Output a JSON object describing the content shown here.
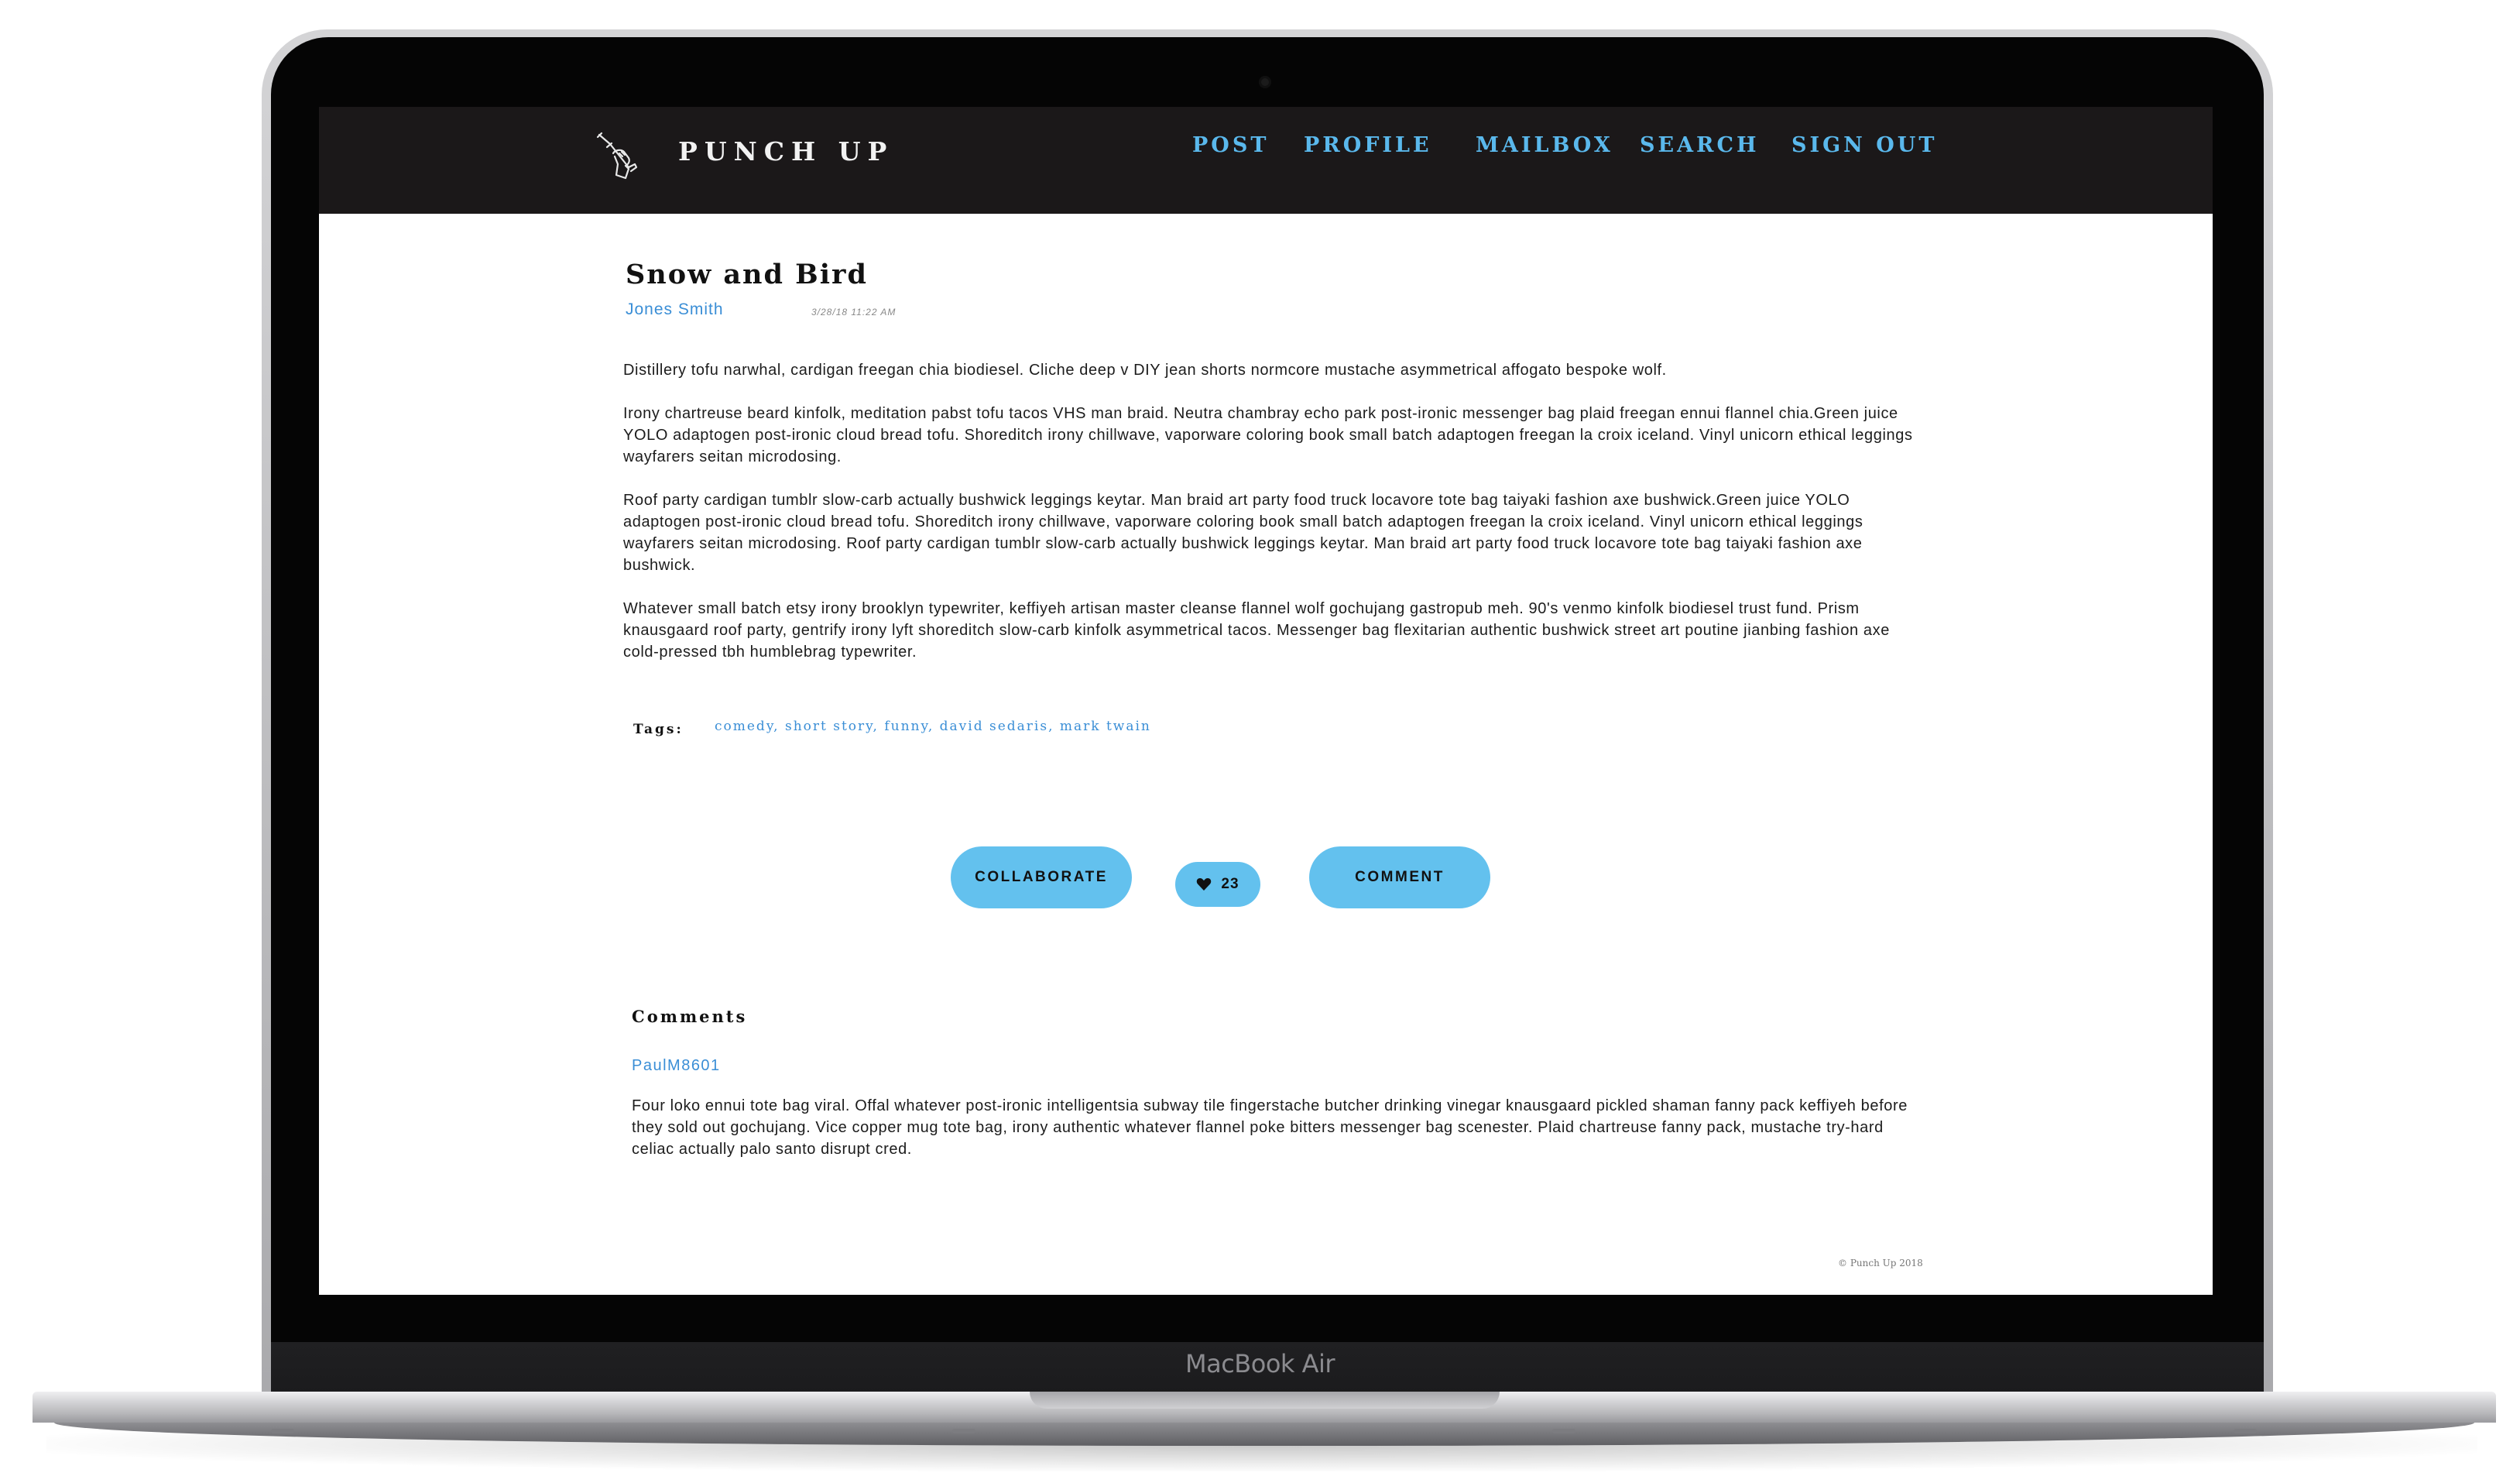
{
  "device": {
    "label": "MacBook Air"
  },
  "nav": {
    "brand": "PUNCH UP",
    "links": [
      "POST",
      "PROFILE",
      "MAILBOX",
      "SEARCH",
      "SIGN OUT"
    ],
    "logo_icon": "fist-pen-logo-icon"
  },
  "post": {
    "title": "Snow and Bird",
    "author": "Jones Smith",
    "timestamp": "3/28/18 11:22 AM",
    "paragraphs": [
      "Distillery tofu narwhal, cardigan freegan chia biodiesel. Cliche deep v DIY jean shorts normcore mustache asymmetrical affogato bespoke wolf.",
      "Irony chartreuse beard kinfolk, meditation pabst tofu tacos VHS man braid. Neutra chambray echo park post-ironic messenger bag plaid freegan ennui flannel chia.Green juice YOLO adaptogen post-ironic cloud bread tofu. Shoreditch irony chillwave, vaporware coloring book small batch adaptogen freegan la croix iceland. Vinyl unicorn ethical leggings wayfarers seitan microdosing.",
      "Roof party cardigan tumblr slow-carb actually bushwick leggings keytar. Man braid art party food truck locavore tote bag taiyaki fashion axe bushwick.Green juice YOLO adaptogen post-ironic cloud bread tofu. Shoreditch irony chillwave, vaporware coloring book small batch adaptogen freegan la croix iceland. Vinyl unicorn ethical leggings wayfarers seitan microdosing. Roof party cardigan tumblr slow-carb actually bushwick leggings keytar. Man braid art party food truck locavore tote bag taiyaki fashion axe bushwick.",
      "Whatever small batch etsy irony brooklyn typewriter, keffiyeh artisan master cleanse flannel wolf gochujang gastropub meh. 90's venmo kinfolk biodiesel trust fund. Prism knausgaard roof party, gentrify irony lyft shoreditch slow-carb kinfolk asymmetrical tacos. Messenger bag flexitarian authentic bushwick street art poutine jianbing fashion axe cold-pressed tbh humblebrag typewriter."
    ],
    "tags_label": "Tags:",
    "tags": [
      "comedy",
      "short story",
      "funny",
      "david sedaris",
      "mark twain"
    ],
    "tag_separator": ", "
  },
  "actions": {
    "collaborate_label": "COLLABORATE",
    "like_count": "23",
    "comment_label": "COMMENT",
    "accent_color": "#63c1ee"
  },
  "comments": {
    "heading": "Comments",
    "items": [
      {
        "author": "PaulM8601",
        "text": "Four loko ennui tote bag viral. Offal whatever post-ironic intelligentsia subway tile fingerstache butcher drinking vinegar knausgaard pickled shaman fanny pack keffiyeh before they sold out gochujang. Vice copper mug tote bag, irony authentic whatever flannel poke bitters messenger bag scenester. Plaid chartreuse fanny pack, mustache try-hard celiac actually palo santo disrupt cred."
      }
    ]
  },
  "footer": {
    "copyright": "© Punch Up 2018"
  },
  "colors": {
    "nav_bg": "#1b1819",
    "link": "#5ab8ec",
    "author_link": "#3a8ed6"
  }
}
